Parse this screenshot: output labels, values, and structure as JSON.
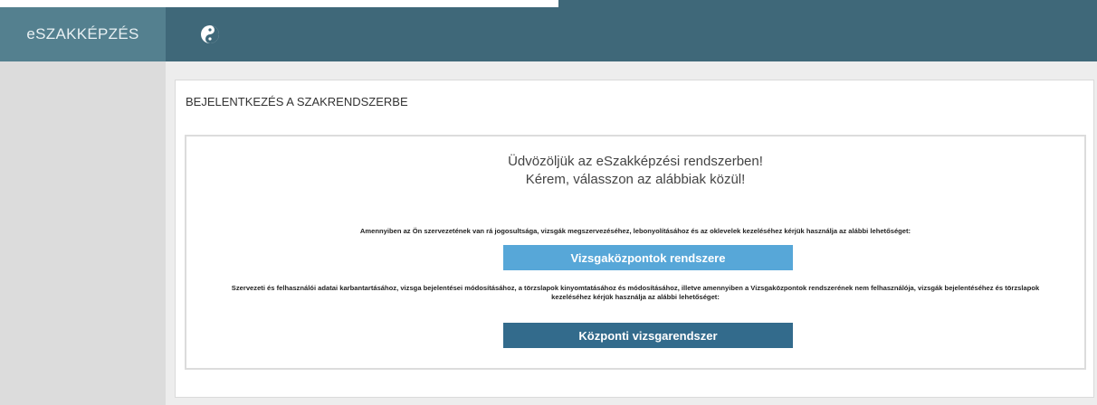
{
  "app": {
    "brand": "eSZAKKÉPZÉS",
    "logo_icon": "yin-yang-icon"
  },
  "panel": {
    "title": "BEJELENTKEZÉS A SZAKRENDSZERBE",
    "welcome_line1": "Üdvözöljük az eSzakképzési rendszerben!",
    "welcome_line2": "Kérem, válasszon az alábbiak közül!",
    "description1": "Amennyiben az Ön szervezetének van rá jogosultsága, vizsgák megszervezéséhez, lebonyolításához és az oklevelek kezeléséhez kérjük használja az alábbi lehetőséget:",
    "button1_label": "Vizsgaközpontok rendszere",
    "description2": "Szervezeti és felhasználói adatai karbantartásához, vizsga bejelentései módosításához, a törzslapok kinyomtatásához és módosításához, illetve amennyiben a Vizsgaközpontok rendszerének nem felhasználója, vizsgák bejelentéséhez és törzslapok kezeléséhez kérjük használja az alábbi lehetőséget:",
    "button2_label": "Központi vizsgarendszer"
  },
  "colors": {
    "topbar": "#3f6879",
    "brand_bg": "#54808f",
    "button1": "#57a7d8",
    "button2": "#336b8c"
  }
}
